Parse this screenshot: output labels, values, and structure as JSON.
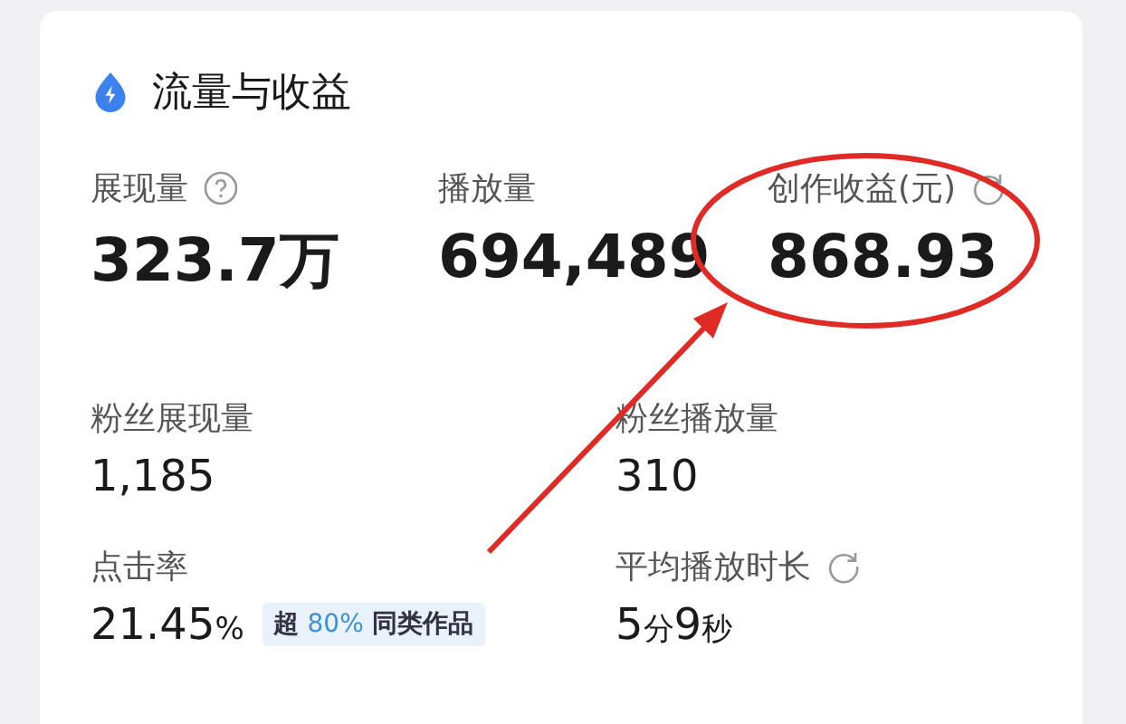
{
  "card": {
    "title": "流量与收益"
  },
  "top_metrics": [
    {
      "label": "展现量",
      "value": "323.7万"
    },
    {
      "label": "播放量",
      "value": "694,489"
    },
    {
      "label": "创作收益(元)",
      "value": "868.93"
    }
  ],
  "metrics": [
    {
      "label": "粉丝展现量",
      "value": [
        {
          "text": "1,185",
          "kind": "number"
        }
      ]
    },
    {
      "label": "粉丝播放量",
      "value": [
        {
          "text": "310",
          "kind": "number"
        }
      ]
    },
    {
      "label": "点击率",
      "value": [
        {
          "text": "21.45",
          "kind": "number"
        },
        {
          "text": "%",
          "kind": "unit"
        }
      ],
      "badge": [
        {
          "text": "超 ",
          "highlight": false
        },
        {
          "text": "80%",
          "highlight": true
        },
        {
          "text": " 同类作品",
          "highlight": false
        }
      ]
    },
    {
      "label": "平均播放时长",
      "value": [
        {
          "text": "5",
          "kind": "number"
        },
        {
          "text": "分",
          "kind": "unit"
        },
        {
          "text": "9",
          "kind": "number"
        },
        {
          "text": "秒",
          "kind": "unit"
        }
      ]
    }
  ],
  "annotation": {
    "kind": "circle-arrow",
    "color": "#e02a25"
  }
}
